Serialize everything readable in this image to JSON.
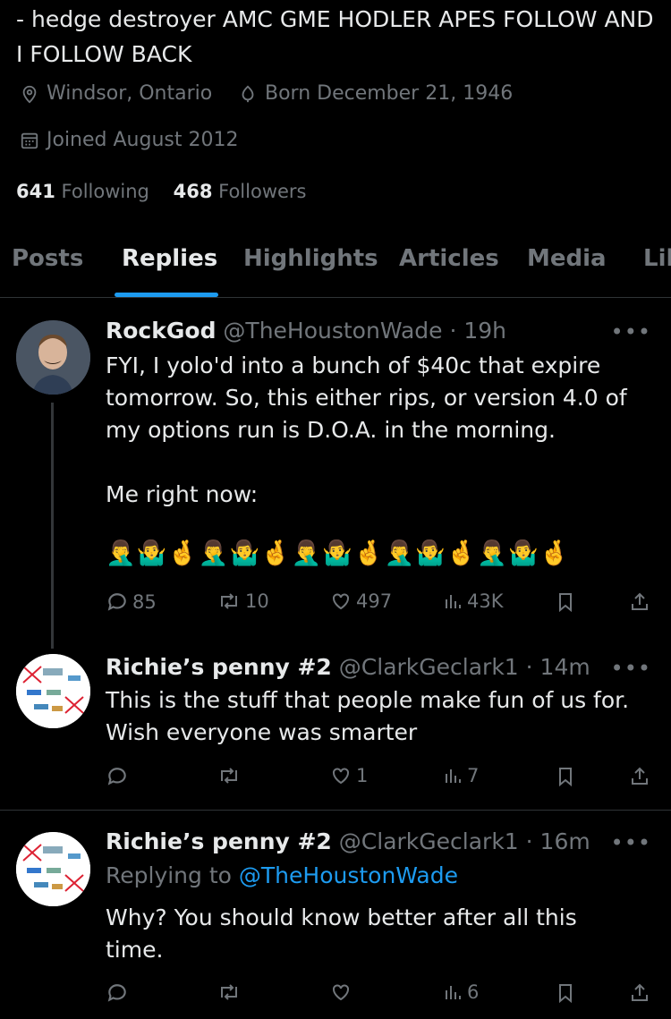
{
  "profile": {
    "bio": "- hedge destroyer AMC GME HODLER APES FOLLOW AND I FOLLOW BACK",
    "location": "Windsor, Ontario",
    "born": "Born December 21, 1946",
    "joined": "Joined August 2012",
    "following_count": "641",
    "following_label": "Following",
    "followers_count": "468",
    "followers_label": "Followers"
  },
  "tabs": [
    {
      "label": "Posts"
    },
    {
      "label": "Replies"
    },
    {
      "label": "Highlights"
    },
    {
      "label": "Articles"
    },
    {
      "label": "Media"
    },
    {
      "label": "Lik"
    }
  ],
  "tweets": [
    {
      "name": "RockGod",
      "handle": "@TheHoustonWade",
      "time": "19h",
      "text_lines": [
        "FYI, I yolo'd into a bunch of $40c that expire",
        "tomorrow. So, this either rips, or version 4.0 of",
        "my options run is D.O.A. in the morning."
      ],
      "text2": "Me right now:",
      "emojis": "🤦‍♂️🤷‍♂️🤞🤦‍♂️🤷‍♂️🤞🤦‍♂️🤷‍♂️🤞🤦‍♂️🤷‍♂️🤞🤦‍♂️🤷‍♂️🤞",
      "replies": "85",
      "reposts": "10",
      "likes": "497",
      "views": "43K"
    },
    {
      "name": "Richie’s penny #2",
      "handle": "@ClarkGeclark1",
      "time": "14m",
      "text_lines": [
        "This is the stuff that people make fun of us for.",
        "Wish everyone was smarter"
      ],
      "replies": "",
      "reposts": "",
      "likes": "1",
      "views": "7"
    },
    {
      "name": "Richie’s penny #2",
      "handle": "@ClarkGeclark1",
      "time": "16m",
      "replying_prefix": "Replying to",
      "replying_handle": "@TheHoustonWade",
      "text_lines": [
        "Why?  You should know better after all this",
        "time."
      ],
      "replies": "",
      "reposts": "",
      "likes": "",
      "views": "6"
    }
  ],
  "colors": {
    "background": "#000000",
    "text": "#e7e9ea",
    "secondary": "#71767b",
    "accent": "#1d9bf0",
    "divider": "#2f3336"
  },
  "icons": [
    "location-icon",
    "birthday-icon",
    "calendar-icon",
    "more-icon",
    "reply-icon",
    "repost-icon",
    "like-icon",
    "views-icon",
    "bookmark-icon",
    "share-icon"
  ]
}
